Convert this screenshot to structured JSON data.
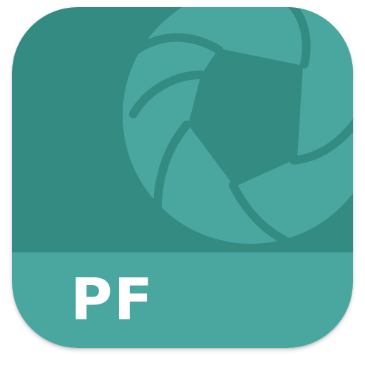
{
  "app_icon": {
    "label": "PF",
    "icon": "camera-aperture-icon",
    "colors": {
      "top_background": "#338b82",
      "bottom_band": "#4aa7a0",
      "aperture": "#4aa7a0",
      "aperture_gaps": "#338b82",
      "label_text": "#ffffff"
    }
  }
}
